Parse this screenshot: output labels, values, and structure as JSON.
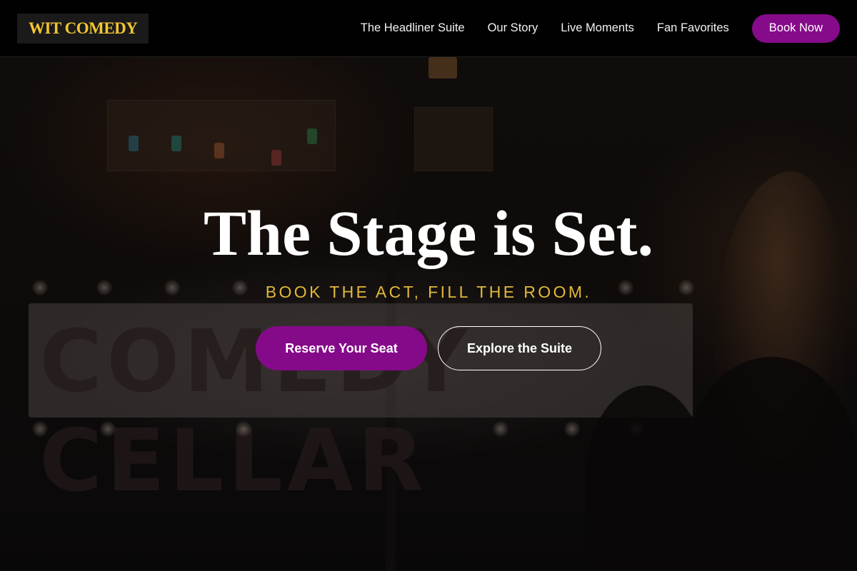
{
  "brand": {
    "logo_text": "WIT COMEDY"
  },
  "nav": {
    "links": [
      "The Headliner Suite",
      "Our Story",
      "Live Moments",
      "Fan Favorites"
    ],
    "cta_label": "Book Now"
  },
  "hero": {
    "title": "The Stage is Set.",
    "subtitle": "BOOK THE ACT, FILL THE ROOM.",
    "primary_cta": "Reserve Your Seat",
    "secondary_cta": "Explore the Suite",
    "background_image": "comedy-club-stage-photo"
  },
  "colors": {
    "brand_gold": "#f2c531",
    "accent_purple": "#860b8a",
    "subtitle_gold": "#e2b93b",
    "nav_bg": "#000000"
  }
}
